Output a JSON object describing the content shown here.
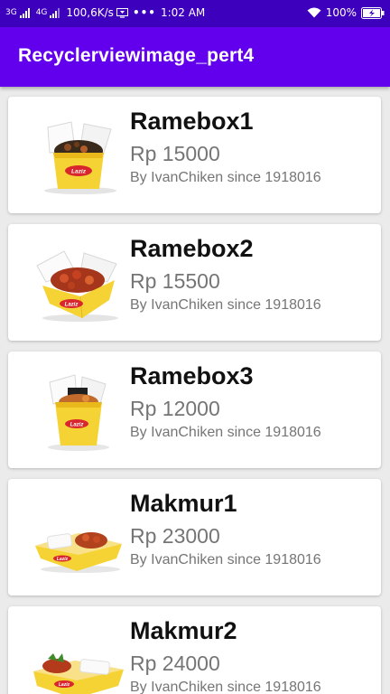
{
  "status_bar": {
    "network1": "3G",
    "network2": "4G",
    "speed": "100,6K/s",
    "dots": "•••",
    "time": "1:02 AM",
    "battery": "100%",
    "icons": [
      "signal-icon",
      "signal-icon",
      "screen-cast-icon",
      "wifi-icon",
      "battery-icon"
    ]
  },
  "app_bar": {
    "title": "Recyclerviewimage_pert4"
  },
  "items": [
    {
      "name": "Ramebox1",
      "price": "Rp 15000",
      "desc": "By IvanChiken since 1918016"
    },
    {
      "name": "Ramebox2",
      "price": "Rp 15500",
      "desc": "By IvanChiken since 1918016"
    },
    {
      "name": "Ramebox3",
      "price": "Rp 12000",
      "desc": "By IvanChiken since 1918016"
    },
    {
      "name": "Makmur1",
      "price": "Rp 23000",
      "desc": "By IvanChiken since 1918016"
    },
    {
      "name": "Makmur2",
      "price": "Rp 24000",
      "desc": "By IvanChiken since 1918016"
    }
  ],
  "colors": {
    "status_bar": "#3d00bd",
    "app_bar": "#6200ee",
    "box_yellow": "#f6d335",
    "brand_red": "#d8262c"
  }
}
